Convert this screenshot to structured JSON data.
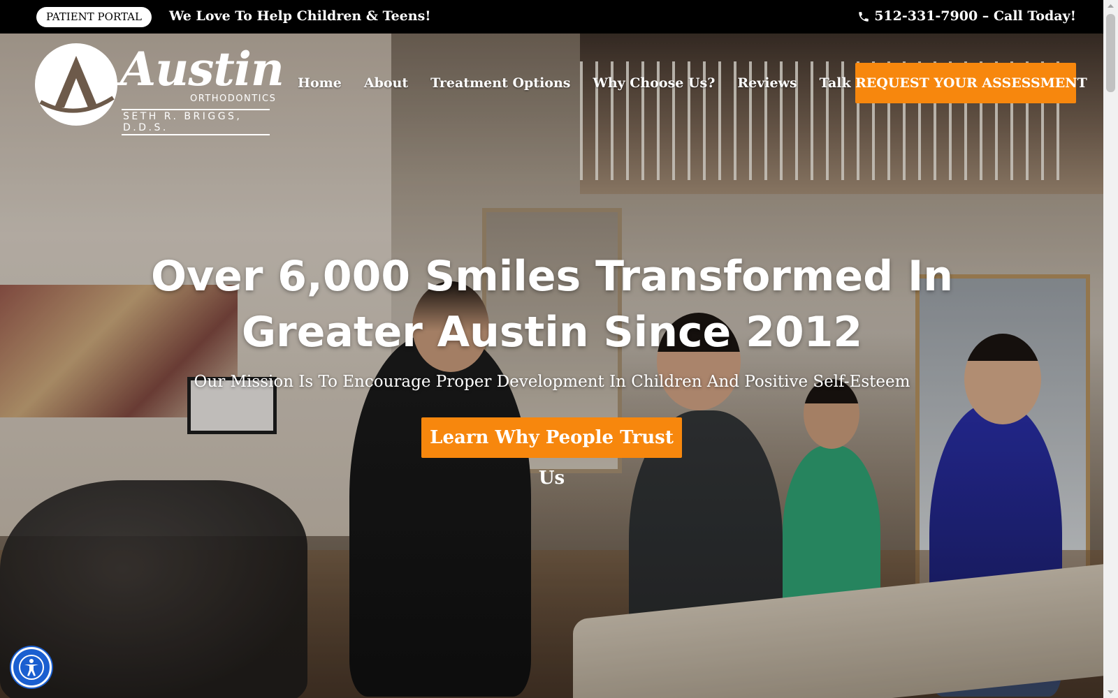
{
  "topbar": {
    "portal_label": "PATIENT PORTAL",
    "tagline": "We Love To Help Children & Teens!",
    "phone": "512-331-7900 – Call Today!",
    "phone_icon": "phone-icon"
  },
  "logo": {
    "word": "Austin",
    "sub1": "ORTHODONTICS",
    "sub2": "SETH R. BRIGGS, D.D.S."
  },
  "nav": {
    "items": [
      {
        "label": "Home"
      },
      {
        "label": "About"
      },
      {
        "label": "Treatment Options"
      },
      {
        "label": "Why Choose Us?"
      },
      {
        "label": "Reviews"
      },
      {
        "label": "Talk To Us"
      }
    ],
    "cta": "REQUEST YOUR ASSESSMENT"
  },
  "hero": {
    "headline_line1": "Over 6,000 Smiles Transformed In",
    "headline_line2": "Greater Austin Since 2012",
    "subhead": "Our Mission Is To Encourage Proper Development In Children And Positive Self-Esteem",
    "cta": "Learn Why People Trust Us"
  },
  "accessibility": {
    "icon": "accessibility-icon"
  },
  "colors": {
    "accent": "#f7870d",
    "topbar": "#000000",
    "accessibility": "#1a5fd0"
  }
}
